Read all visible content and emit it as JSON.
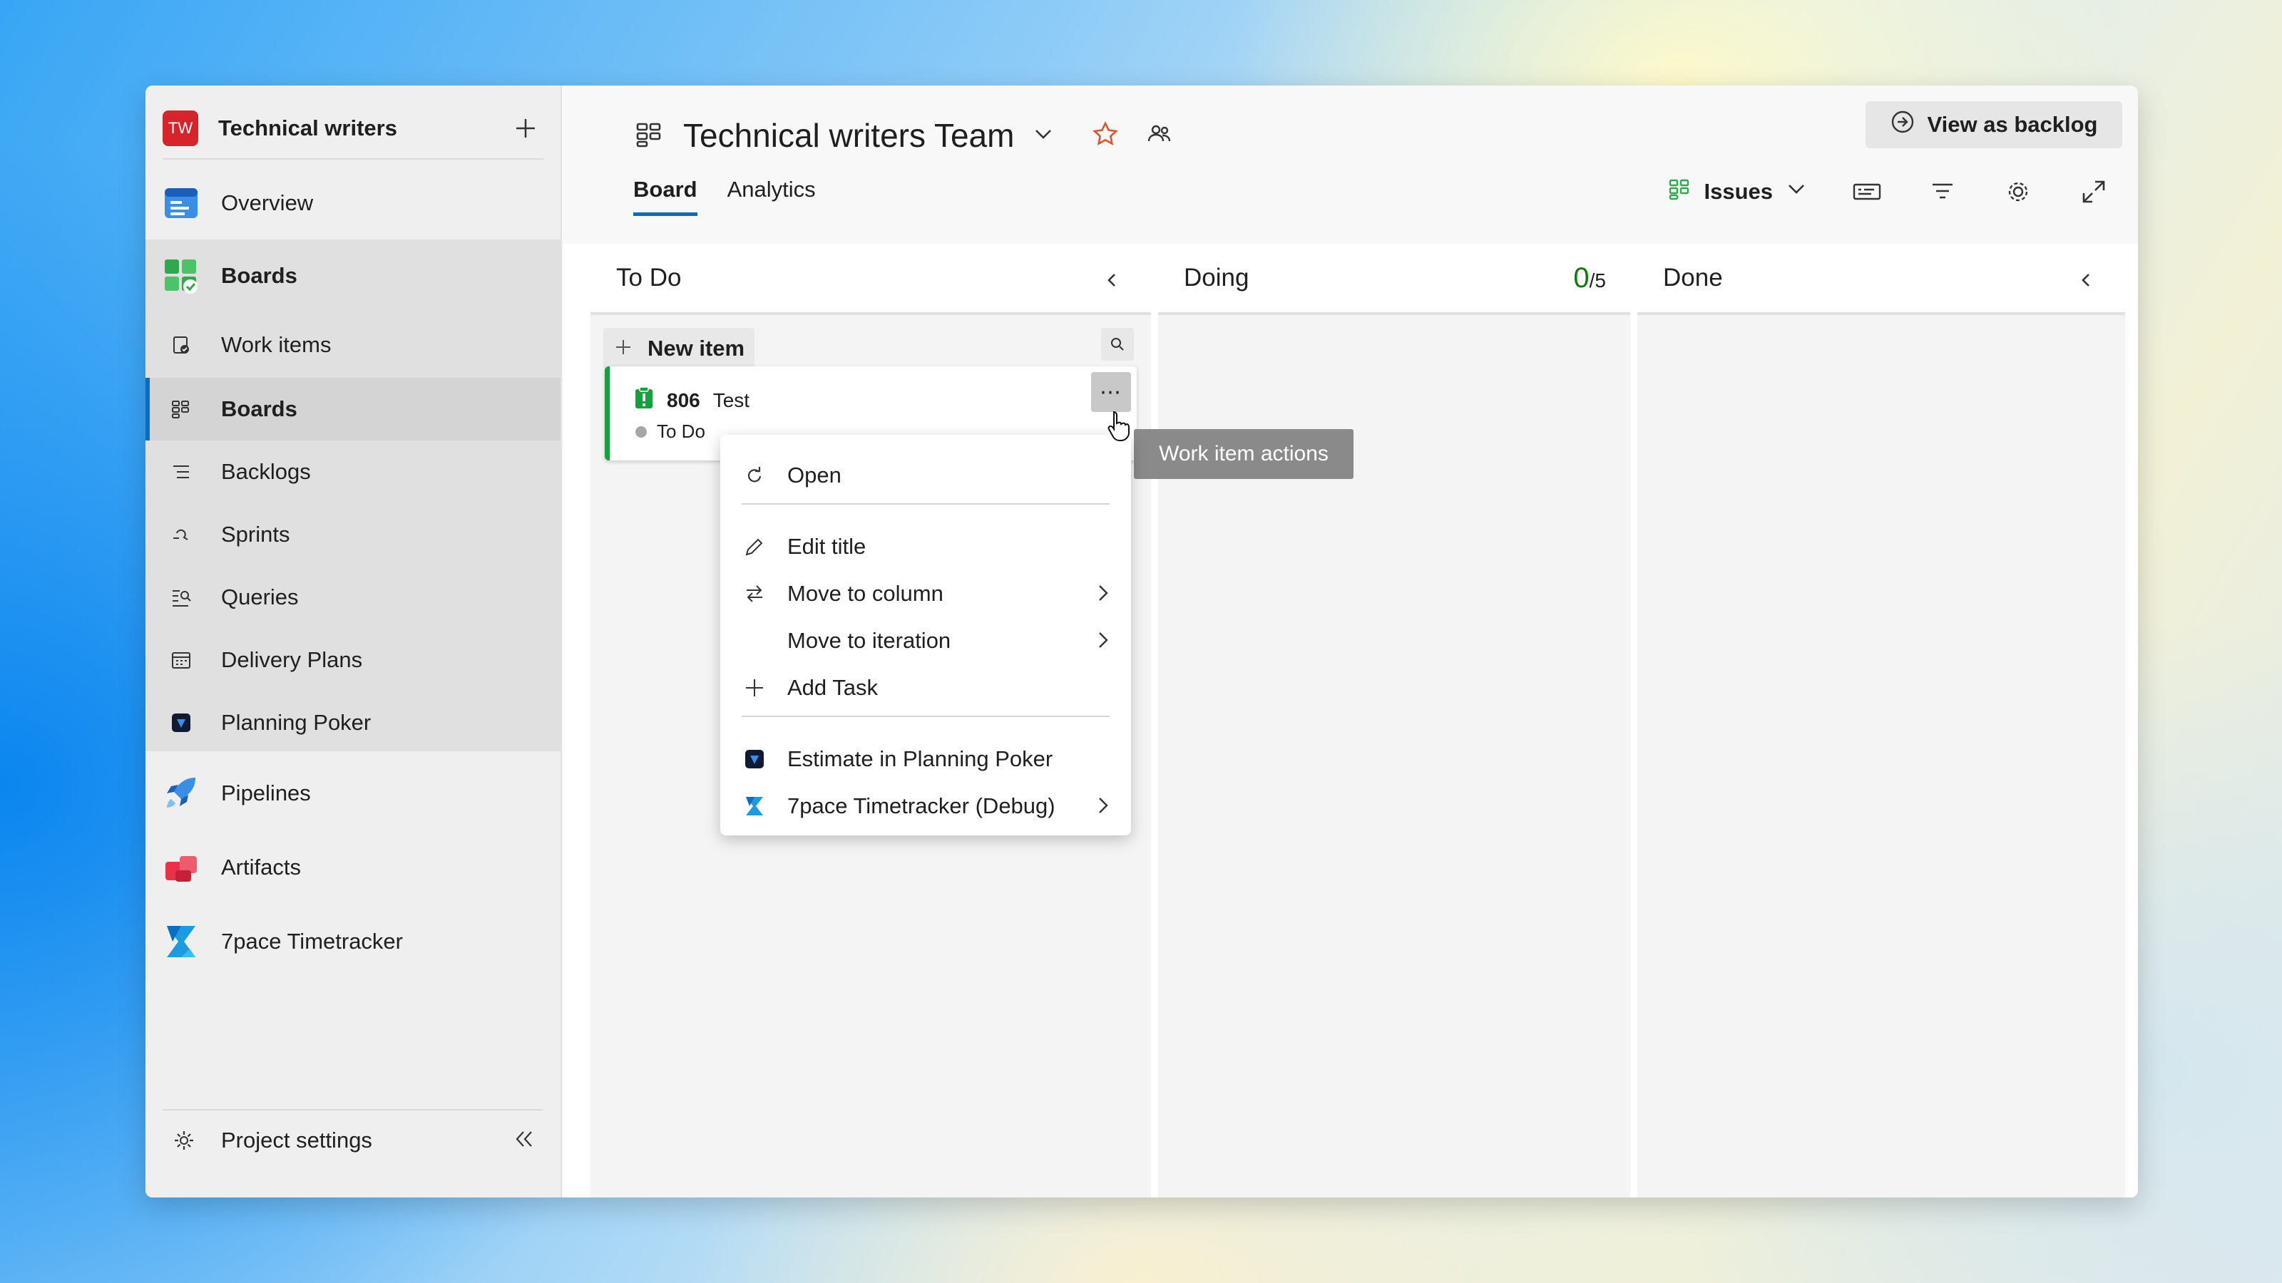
{
  "project": {
    "badge": "TW",
    "name": "Technical writers"
  },
  "sidebar": {
    "items": [
      {
        "label": "Overview"
      },
      {
        "label": "Boards"
      },
      {
        "label": "Work items"
      },
      {
        "label": "Boards"
      },
      {
        "label": "Backlogs"
      },
      {
        "label": "Sprints"
      },
      {
        "label": "Queries"
      },
      {
        "label": "Delivery Plans"
      },
      {
        "label": "Planning Poker"
      },
      {
        "label": "Pipelines"
      },
      {
        "label": "Artifacts"
      },
      {
        "label": "7pace Timetracker"
      }
    ],
    "footer": {
      "label": "Project settings"
    }
  },
  "header": {
    "team_name": "Technical writers Team",
    "view_backlog": "View as backlog",
    "tabs": [
      {
        "label": "Board"
      },
      {
        "label": "Analytics"
      }
    ],
    "work_item_type": "Issues"
  },
  "board": {
    "columns": [
      {
        "name": "To Do"
      },
      {
        "name": "Doing",
        "wip_current": "0",
        "wip_limit": "/5"
      },
      {
        "name": "Done"
      }
    ],
    "new_item_label": "New item",
    "card": {
      "id": "806",
      "title": "Test",
      "state": "To Do"
    }
  },
  "tooltip": "Work item actions",
  "context_menu": {
    "items": [
      {
        "label": "Open"
      },
      {
        "label": "Edit title"
      },
      {
        "label": "Move to column"
      },
      {
        "label": "Move to iteration"
      },
      {
        "label": "Add Task"
      },
      {
        "label": "Estimate in Planning Poker"
      },
      {
        "label": "7pace Timetracker (Debug)"
      }
    ]
  },
  "colors": {
    "accent": "#0f6cbd",
    "badge": "#d6242a",
    "card_stripe": "#14a03c",
    "wip_ok": "#107c10",
    "favorite_star": "#e0542a"
  }
}
